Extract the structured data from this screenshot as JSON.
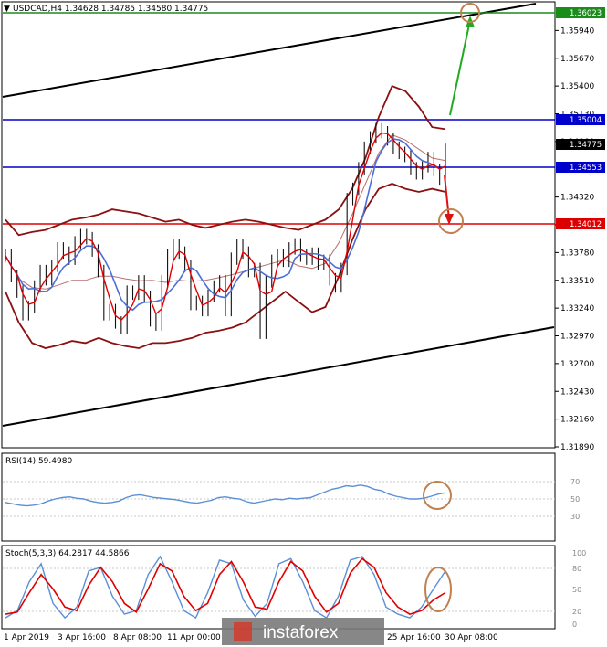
{
  "header": {
    "triangle": "▼",
    "title": "USDCAD,H4 1.34628 1.34785 1.34580 1.34775"
  },
  "price_axis": {
    "ticks": [
      "1.35940",
      "1.35670",
      "1.35400",
      "1.35130",
      "1.34860",
      "1.34320",
      "1.34050",
      "1.33780",
      "1.33510",
      "1.33240",
      "1.32970",
      "1.32700",
      "1.32430",
      "1.32160",
      "1.31890"
    ]
  },
  "price_labels": {
    "top": "1.36023",
    "res": "1.35004",
    "cur": "1.34775",
    "sup": "1.34553",
    "red": "1.34012"
  },
  "rsi": {
    "title": "RSI(14) 59.4980",
    "levels": [
      "70",
      "50",
      "30"
    ]
  },
  "stoch": {
    "title": "Stoch(5,3,3) 64.2817 44.5866",
    "levels": [
      "100",
      "80",
      "50",
      "20",
      "0"
    ]
  },
  "time_axis": {
    "labels": [
      "1 Apr 2019",
      "3 Apr 16:00",
      "8 Apr 08:00",
      "11 Apr 00:00",
      "25 Apr 16:00",
      "30 Apr 08:00"
    ]
  },
  "watermark": {
    "text": "instaforex"
  },
  "colors": {
    "bg": "#ffffff",
    "black_line": "#000000",
    "blue_level": "#0000cc",
    "green_level": "#1a8c1a",
    "red_level": "#dd0000",
    "bollinger": "#8b1010",
    "ma_fast": "#e00000",
    "ma_slow": "#4a6fd8",
    "arrow_green": "#22aa22",
    "arrow_red": "#dd1111",
    "circle": "#c08050",
    "rsi": "#5b8fd6",
    "stoch_main": "#5b8fd6",
    "stoch_signal": "#e00000",
    "watermark_bg": "#7a7a7a"
  },
  "chart_data": {
    "type": "line",
    "symbol": "USDCAD",
    "timeframe": "H4",
    "ylim": [
      1.3189,
      1.3621
    ],
    "levels": [
      1.36023,
      1.35004,
      1.34553,
      1.34012
    ],
    "x_labels": [
      "1 Apr 2019",
      "3 Apr 16:00",
      "8 Apr 08:00",
      "11 Apr 00:00",
      "25 Apr 16:00",
      "30 Apr 08:00"
    ],
    "price_close": [
      1.3375,
      1.3355,
      1.334,
      1.3318,
      1.3325,
      1.3345,
      1.336,
      1.3352,
      1.3365,
      1.3382,
      1.3378,
      1.3372,
      1.3388,
      1.3395,
      1.3392,
      1.338,
      1.336,
      1.3318,
      1.3322,
      1.331,
      1.3305,
      1.334,
      1.3338,
      1.335,
      1.3335,
      1.3312,
      1.3308,
      1.335,
      1.3375,
      1.3385,
      1.3378,
      1.3365,
      1.3328,
      1.333,
      1.3322,
      1.3336,
      1.3345,
      1.335,
      1.3322,
      1.3372,
      1.3385,
      1.3378,
      1.336,
      1.3362,
      1.33,
      1.335,
      1.337,
      1.3375,
      1.337,
      1.3382,
      1.3386,
      1.3375,
      1.3372,
      1.3377,
      1.3367,
      1.337,
      1.3352,
      1.3345,
      1.3362,
      1.343,
      1.344,
      1.346,
      1.348,
      1.349,
      1.3498,
      1.3495,
      1.3488,
      1.348,
      1.3475,
      1.3472,
      1.346,
      1.3455,
      1.3462,
      1.347,
      1.3458,
      1.345,
      1.3478
    ],
    "bollinger_upper": [
      1.341,
      1.3395,
      1.3398,
      1.34,
      1.3405,
      1.341,
      1.3412,
      1.3415,
      1.342,
      1.3418,
      1.3416,
      1.3412,
      1.3408,
      1.341,
      1.3405,
      1.3402,
      1.3405,
      1.3408,
      1.341,
      1.3408,
      1.3405,
      1.3402,
      1.34,
      1.3405,
      1.341,
      1.342,
      1.344,
      1.347,
      1.351,
      1.354,
      1.3535,
      1.352,
      1.35,
      1.3498
    ],
    "bollinger_lower": [
      1.334,
      1.331,
      1.329,
      1.3285,
      1.3288,
      1.3292,
      1.329,
      1.3295,
      1.329,
      1.3287,
      1.3285,
      1.329,
      1.329,
      1.3292,
      1.3295,
      1.33,
      1.3302,
      1.3305,
      1.331,
      1.332,
      1.333,
      1.334,
      1.333,
      1.332,
      1.3325,
      1.3355,
      1.339,
      1.342,
      1.344,
      1.3445,
      1.344,
      1.3437,
      1.344,
      1.3437
    ],
    "rsi14": [
      45,
      43,
      41,
      40,
      41,
      43,
      47,
      50,
      52,
      53,
      51,
      50,
      47,
      45,
      44,
      45,
      47,
      52,
      55,
      56,
      54,
      52,
      51,
      50,
      49,
      47,
      45,
      44,
      46,
      48,
      52,
      53,
      51,
      50,
      46,
      44,
      46,
      48,
      50,
      49,
      51,
      50,
      51,
      52,
      56,
      60,
      64,
      66,
      69,
      68,
      70,
      68,
      64,
      62,
      57,
      54,
      52,
      50,
      50,
      51,
      54,
      57,
      59
    ],
    "stoch_k": [
      10,
      20,
      60,
      85,
      30,
      10,
      25,
      75,
      80,
      40,
      15,
      20,
      70,
      95,
      60,
      20,
      10,
      45,
      90,
      85,
      35,
      12,
      30,
      85,
      92,
      60,
      20,
      10,
      40,
      90,
      95,
      70,
      25,
      15,
      10,
      25,
      50,
      75
    ],
    "stoch_d": [
      15,
      18,
      45,
      70,
      50,
      25,
      20,
      55,
      80,
      60,
      30,
      18,
      50,
      85,
      75,
      40,
      20,
      30,
      70,
      88,
      60,
      25,
      22,
      60,
      88,
      75,
      40,
      18,
      30,
      72,
      92,
      80,
      45,
      25,
      15,
      20,
      35,
      45
    ]
  }
}
